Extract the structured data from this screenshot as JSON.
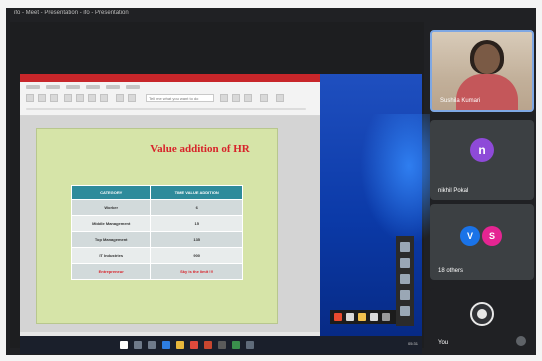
{
  "meeting": {
    "title_text": "ifo - Meet - Presentation - ifo - Presentation"
  },
  "slide": {
    "title": "Value addition of HR",
    "table": {
      "headers": [
        "CATEGORY",
        "TIME VALUE ADDITION"
      ],
      "rows": [
        [
          "Worker",
          "6"
        ],
        [
          "Middle Management",
          "15"
        ],
        [
          "Top Management",
          "135"
        ],
        [
          "IT Industries",
          "900"
        ],
        [
          "Entrepreneur",
          "Sky is the limit !!!"
        ]
      ]
    }
  },
  "toolbar": {
    "search_hint": "Tell me what you want to do"
  },
  "taskbar": {
    "clock": "05:31"
  },
  "participants": [
    {
      "name": "Sushila Kumari",
      "type": "video"
    },
    {
      "name": "nikhil Pokal",
      "avatar_letter": "n",
      "avatar_color": "#8e4ad8"
    },
    {
      "name": "18 others",
      "avatar_letters": [
        "V",
        "S"
      ],
      "avatar_colors": [
        "#1a73e8",
        "#e52592"
      ]
    },
    {
      "name": "You",
      "type": "self-view"
    }
  ],
  "colors": {
    "accent_red": "#d8232a",
    "table_header_teal": "#2e8b9b",
    "slide_background": "#d6e4a8",
    "meet_background": "#202124"
  },
  "icons": [
    "windows-start-icon",
    "search-icon",
    "task-view-icon",
    "edge-icon",
    "file-explorer-icon",
    "chrome-icon",
    "powerpoint-icon",
    "obs-icon",
    "mic-off-icon"
  ]
}
